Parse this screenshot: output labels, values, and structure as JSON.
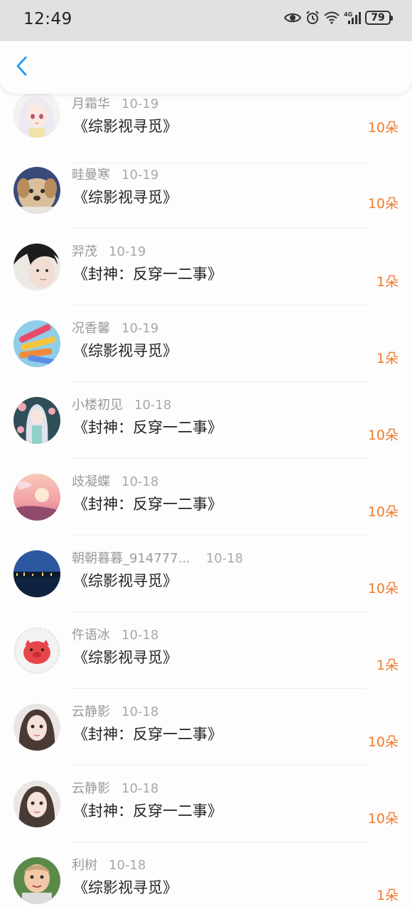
{
  "status_bar": {
    "time": "12:49",
    "battery": "79",
    "network": "4G"
  },
  "nav": {
    "back_icon": "chevron-left-icon",
    "accent_color": "#2f9bf0"
  },
  "colors": {
    "amount": "#f07a2e",
    "name": "#9a9a9a",
    "title": "#222222"
  },
  "items": [
    {
      "name": "月霜华",
      "date": "10-19",
      "book": "《综影视寻觅》",
      "amount": "10朵",
      "avatar": "anime-girl-white-hair"
    },
    {
      "name": "畦曼寒",
      "date": "10-19",
      "book": "《综影视寻觅》",
      "amount": "10朵",
      "avatar": "puppy"
    },
    {
      "name": "羿茂",
      "date": "10-19",
      "book": "《封神：反穿一二事》",
      "amount": "1朵",
      "avatar": "woman-photo"
    },
    {
      "name": "况香馨",
      "date": "10-19",
      "book": "《综影视寻觅》",
      "amount": "1朵",
      "avatar": "crayons"
    },
    {
      "name": "小楼初见",
      "date": "10-18",
      "book": "《封神：反穿一二事》",
      "amount": "10朵",
      "avatar": "anime-girl-flowers"
    },
    {
      "name": "歧凝蝶",
      "date": "10-18",
      "book": "《封神：反穿一二事》",
      "amount": "10朵",
      "avatar": "pink-sunset"
    },
    {
      "name": "朝朝暮暮_914777...",
      "date": "10-18",
      "book": "《综影视寻觅》",
      "amount": "10朵",
      "avatar": "night-city"
    },
    {
      "name": "仵语冰",
      "date": "10-18",
      "book": "《综影视寻觅》",
      "amount": "1朵",
      "avatar": "red-pig"
    },
    {
      "name": "云静影",
      "date": "10-18",
      "book": "《封神：反穿一二事》",
      "amount": "10朵",
      "avatar": "girl-portrait"
    },
    {
      "name": "云静影",
      "date": "10-18",
      "book": "《封神：反穿一二事》",
      "amount": "10朵",
      "avatar": "girl-portrait"
    },
    {
      "name": "利树",
      "date": "10-18",
      "book": "《综影视寻觅》",
      "amount": "1朵",
      "avatar": "baby-photo"
    }
  ]
}
